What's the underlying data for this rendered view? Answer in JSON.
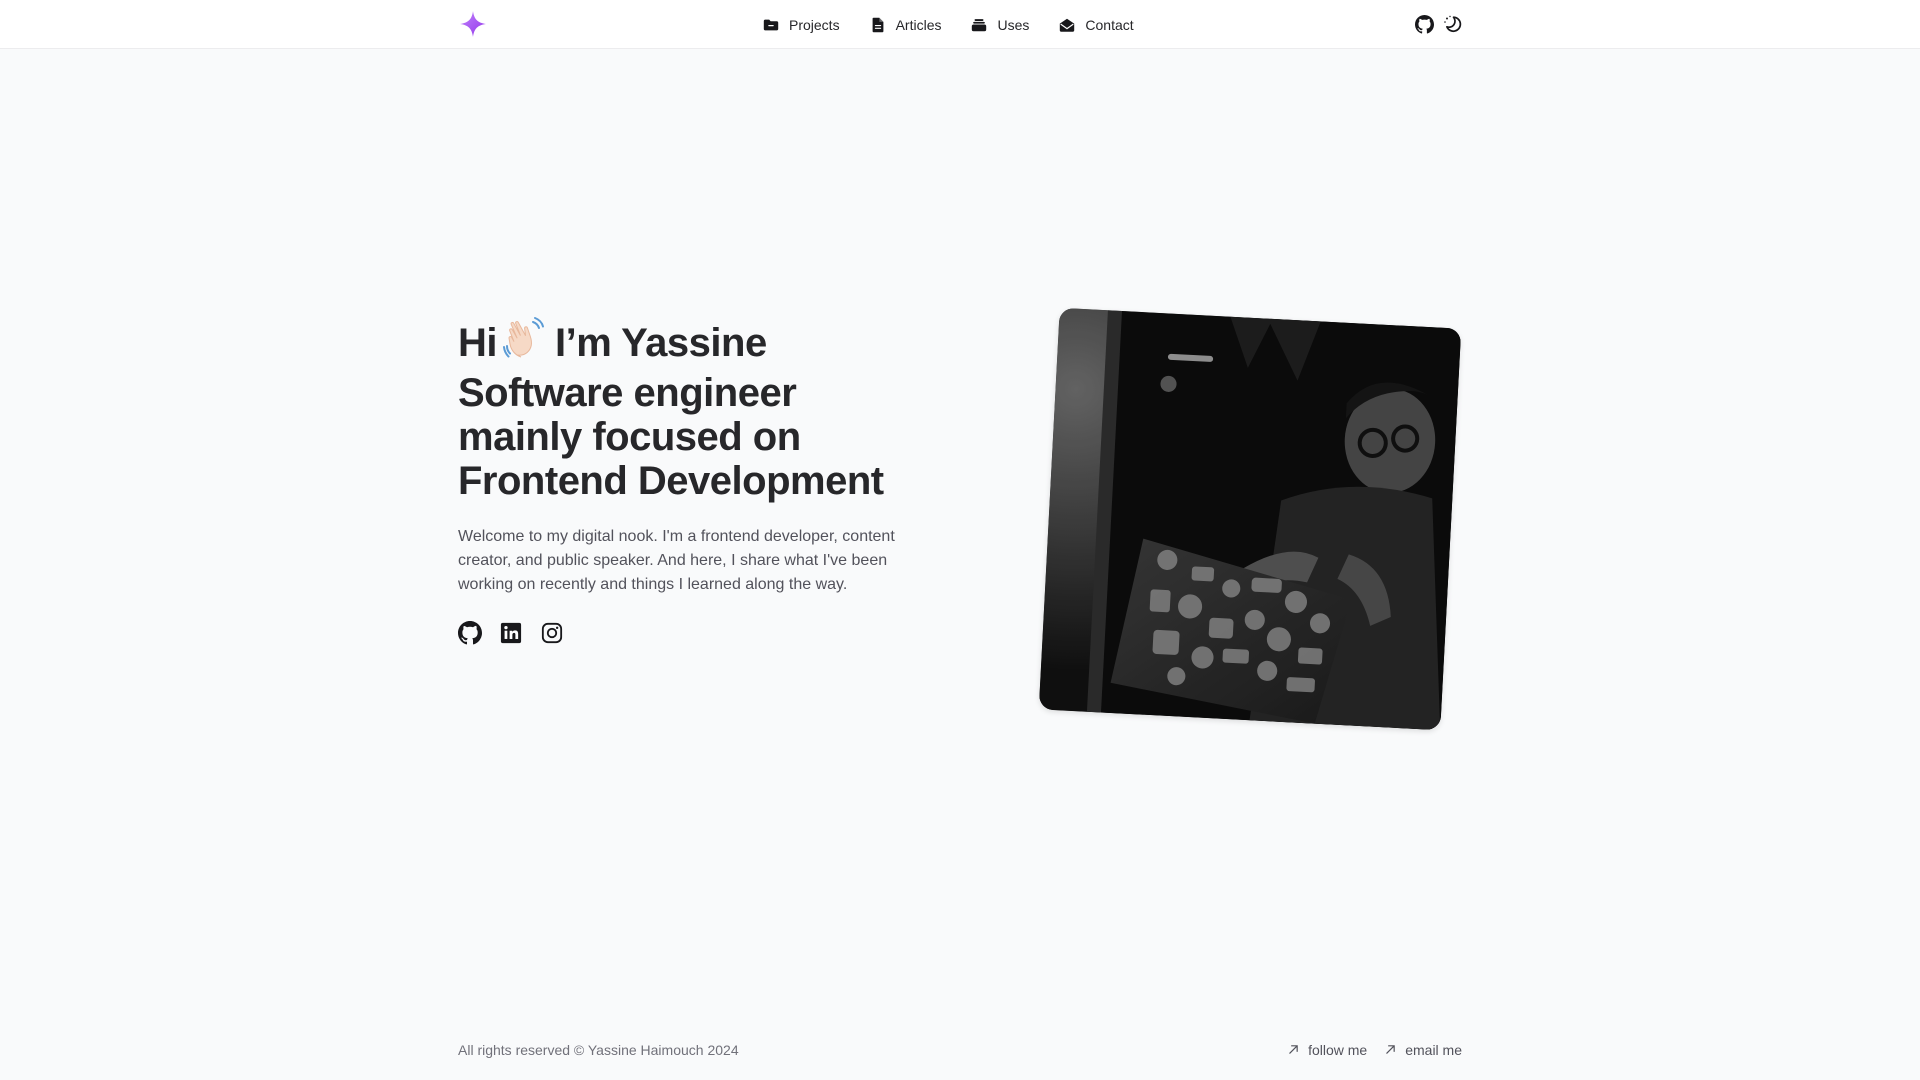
{
  "header": {
    "logo_icon": "sparkle-icon",
    "logo_color": "#a855f7",
    "nav": [
      {
        "label": "Projects",
        "icon": "folder-icon"
      },
      {
        "label": "Articles",
        "icon": "document-icon"
      },
      {
        "label": "Uses",
        "icon": "layers-icon"
      },
      {
        "label": "Contact",
        "icon": "envelope-open-icon"
      }
    ],
    "actions": [
      {
        "icon": "github-icon"
      },
      {
        "icon": "theme-toggle-icon"
      }
    ]
  },
  "hero": {
    "headline_hi": "Hi",
    "headline_wave_emoji": "👋",
    "headline_name": "I’m Yassine",
    "headline_line2": "Software engineer",
    "headline_line3": "mainly focused on",
    "headline_line4": "Frontend Development",
    "intro": "Welcome to my digital nook. I'm a frontend developer, content creator, and public speaker. And here, I share what I've been working on recently and things I learned along the way.",
    "socials": [
      {
        "icon": "github-icon"
      },
      {
        "icon": "linkedin-icon"
      },
      {
        "icon": "instagram-icon"
      }
    ],
    "photo": {
      "icon": "profile-photo",
      "tint": "grayscale"
    }
  },
  "footer": {
    "copyright": "All rights reserved © Yassine Haimouch 2024",
    "links": [
      {
        "label": "follow me",
        "icon": "arrow-up-right-icon"
      },
      {
        "label": "email me",
        "icon": "arrow-up-right-icon"
      }
    ]
  },
  "colors": {
    "background": "#f9fafb",
    "header_bg": "#ffffff",
    "text_primary": "#27272a",
    "text_secondary": "#52525b",
    "accent": "#a855f7"
  }
}
